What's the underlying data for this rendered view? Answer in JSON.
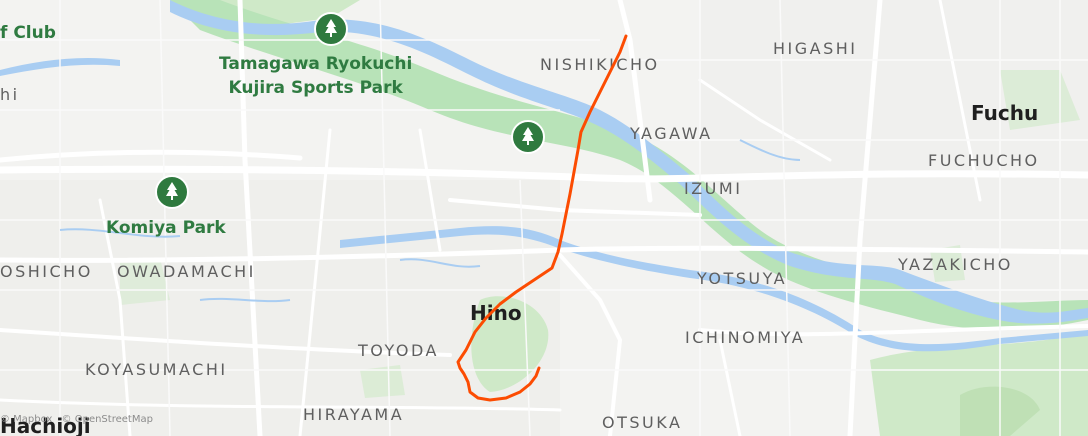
{
  "map": {
    "place_labels": [
      {
        "id": "golf-club",
        "text": "f Club"
      },
      {
        "id": "nishikicho",
        "text": "NISHIKICHO"
      },
      {
        "id": "higashi",
        "text": "HIGASHI"
      },
      {
        "id": "fuchu",
        "text": "Fuchu"
      },
      {
        "id": "yagawa",
        "text": "YAGAWA"
      },
      {
        "id": "fuchucho",
        "text": "FUCHUCHO"
      },
      {
        "id": "izumi",
        "text": "IZUMI"
      },
      {
        "id": "oshicho",
        "text": "OSHICHO"
      },
      {
        "id": "owadamachi",
        "text": "OWADAMACHI"
      },
      {
        "id": "yotsuya",
        "text": "YOTSUYA"
      },
      {
        "id": "yazakicho",
        "text": "YAZAKICHO"
      },
      {
        "id": "hino",
        "text": "Hino"
      },
      {
        "id": "ichinomiya",
        "text": "ICHINOMIYA"
      },
      {
        "id": "toyoda",
        "text": "TOYODA"
      },
      {
        "id": "koyasumachi",
        "text": "KOYASUMACHI"
      },
      {
        "id": "hirayama",
        "text": "HIRAYAMA"
      },
      {
        "id": "otsuka",
        "text": "OTSUKA"
      },
      {
        "id": "hachioji",
        "text": "Hachioji"
      },
      {
        "id": "edge-hi",
        "text": "hi"
      }
    ],
    "parks": [
      {
        "id": "tamagawa",
        "lines": [
          "Tamagawa Ryokuchi",
          "Kujira Sports Park"
        ]
      },
      {
        "id": "komiya",
        "lines": [
          "Komiya Park"
        ]
      }
    ],
    "credits": [
      "© Mapbox",
      "© OpenStreetMap"
    ],
    "colors": {
      "route": "#fc4c02",
      "river": "#a9cdf2",
      "river_bank": "#b8e3b8",
      "park": "#cfe9c8",
      "park_pin": "#2f7a3f",
      "road": "#ffffff",
      "background": "#f3f3f1"
    },
    "icons": {
      "park_pin": "tree-icon"
    }
  }
}
